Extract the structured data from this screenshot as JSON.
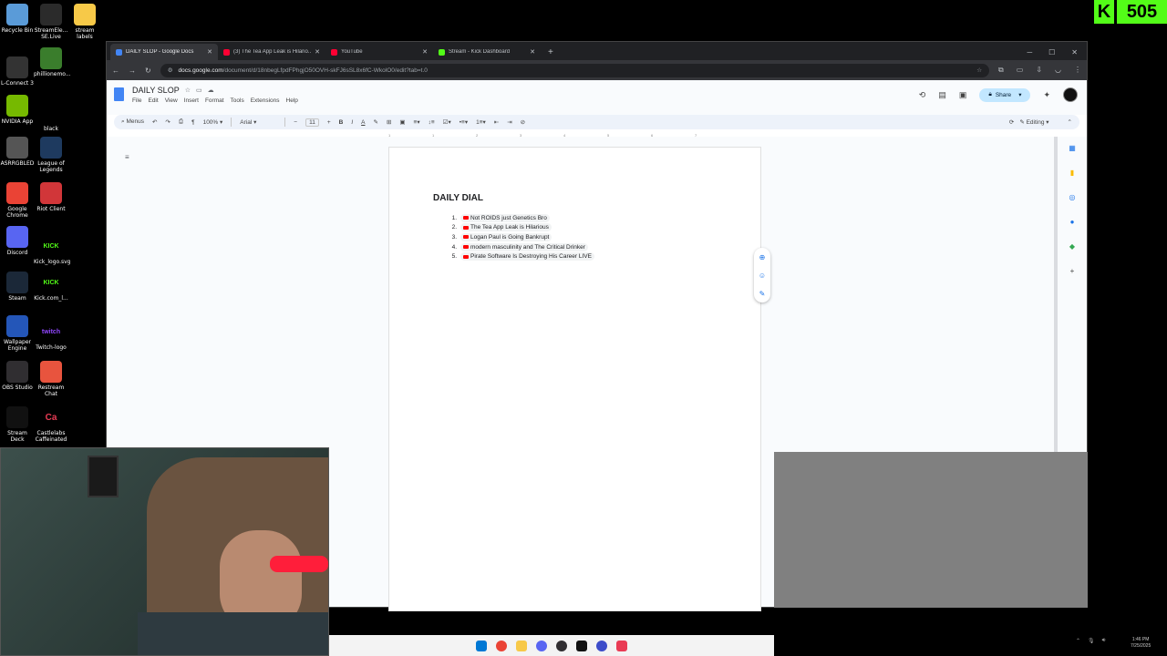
{
  "desktop": {
    "icons": [
      {
        "label": "Recycle Bin",
        "icon": "recycle-bin-icon",
        "color": "#5a9bd8"
      },
      {
        "label": "StreamEle... SE.Live",
        "icon": "streamelements-icon",
        "color": "#2b2b2b"
      },
      {
        "label": "stream labels",
        "icon": "folder-icon",
        "color": "#f7c948"
      },
      {
        "label": "L-Connect 3",
        "icon": "lconnect-icon",
        "color": "#333333"
      },
      {
        "label": "phillionemo...",
        "icon": "shortcut-icon",
        "color": "#3a7d2c"
      },
      {
        "label": "NVIDIA App",
        "icon": "nvidia-icon",
        "color": "#76b900"
      },
      {
        "label": "black",
        "icon": "black-file-icon",
        "color": "#000000"
      },
      {
        "label": "ASRRGBLED",
        "icon": "asrock-icon",
        "color": "#555555"
      },
      {
        "label": "League of Legends",
        "icon": "league-icon",
        "color": "#1e3a5f"
      },
      {
        "label": "Google Chrome",
        "icon": "chrome-icon",
        "color": "#ea4335"
      },
      {
        "label": "Riot Client",
        "icon": "riot-icon",
        "color": "#d13639"
      },
      {
        "label": "Discord",
        "icon": "discord-icon",
        "color": "#5865f2"
      },
      {
        "label": "Kick_logo.svg",
        "icon": "kick-logo-icon",
        "color": "#53fc18",
        "glyph": "KICK"
      },
      {
        "label": "Steam",
        "icon": "steam-icon",
        "color": "#1b2838"
      },
      {
        "label": "Kick.com_l...",
        "icon": "kick-logo-icon",
        "color": "#53fc18",
        "glyph": "KICK"
      },
      {
        "label": "Wallpaper Engine",
        "icon": "wallpaper-engine-icon",
        "color": "#2456b8"
      },
      {
        "label": "Twitch-logo",
        "icon": "twitch-icon",
        "color": "#9146ff",
        "glyph": "twitch"
      },
      {
        "label": "OBS Studio",
        "icon": "obs-icon",
        "color": "#302e31"
      },
      {
        "label": "Restream Chat",
        "icon": "restream-icon",
        "color": "#e8543e"
      },
      {
        "label": "Stream Deck",
        "icon": "stream-deck-icon",
        "color": "#111111"
      },
      {
        "label": "Castlelabs Caffeinated",
        "icon": "caffeinated-icon",
        "color": "#e93b54",
        "glyph": "Ca"
      }
    ]
  },
  "kick_badge": {
    "letter": "K",
    "count": "505"
  },
  "browser": {
    "tabs": [
      {
        "label": "DAILY SLOP - Google Docs",
        "color": "#4285f4",
        "active": true
      },
      {
        "label": "(3) The Tea App Leak is Hilario...",
        "color": "#ff0033",
        "active": false
      },
      {
        "label": "YouTube",
        "color": "#ff0033",
        "active": false
      },
      {
        "label": "Stream - Kick Dashboard",
        "color": "#53fc18",
        "active": false
      }
    ],
    "url_host": "docs.google.com",
    "url_path": "/document/d/18nbegLfpdFPhgjO50OVH-skFJ6sSL8x6fC-WkolO0/edit?tab=t.0"
  },
  "docs": {
    "title": "DAILY SLOP",
    "menus": [
      "File",
      "Edit",
      "View",
      "Insert",
      "Format",
      "Tools",
      "Extensions",
      "Help"
    ],
    "share_label": "Share",
    "toolbar": {
      "menus_label": "Menus",
      "zoom": "100%",
      "font": "Arial",
      "font_size": "11",
      "mode": "Editing"
    },
    "ruler_ticks": [
      "1",
      "1",
      "2",
      "3",
      "4",
      "5",
      "6",
      "7"
    ],
    "heading": "DAILY DIAL",
    "list": [
      {
        "n": "1.",
        "text": "Not ROIDS just Genetics Bro"
      },
      {
        "n": "2.",
        "text": "The Tea App Leak is Hilarious"
      },
      {
        "n": "3.",
        "text": "Logan Paul is Going Bankrupt"
      },
      {
        "n": "4.",
        "text": "modern masculinity and The Critical Drinker"
      },
      {
        "n": "5.",
        "text": "Pirate Software Is Destroying His Career LIVE"
      }
    ]
  },
  "taskbar": {
    "clock_time": "1:46 PM",
    "clock_date": "7/25/2025"
  }
}
